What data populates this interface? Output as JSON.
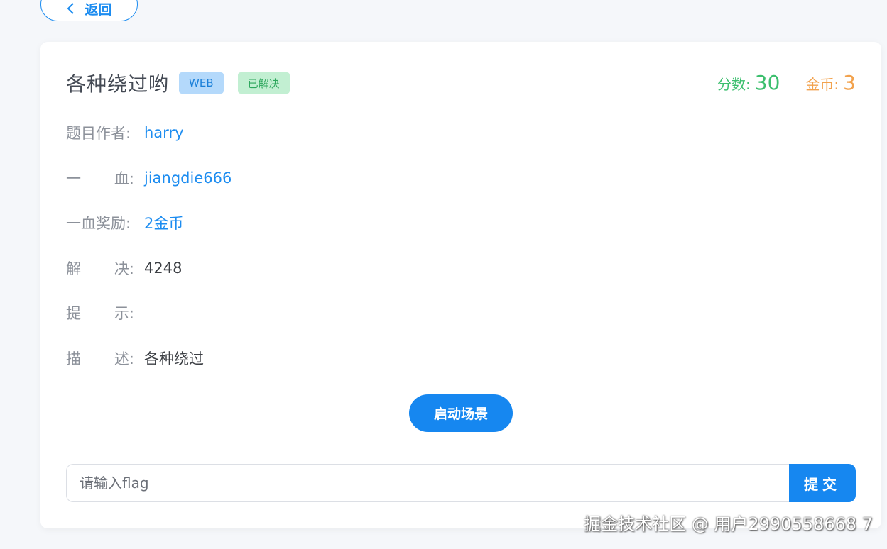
{
  "back": {
    "label": "返回",
    "icon": "chevron-left-icon"
  },
  "challenge": {
    "title": "各种绕过哟",
    "category_tag": "WEB",
    "status_tag": "已解决",
    "score_label": "分数:",
    "score_value": "30",
    "coin_label": "金币:",
    "coin_value": "3"
  },
  "info": {
    "author_label": "题目作者:",
    "author_value": "harry",
    "first_blood_label_a": "一",
    "first_blood_label_b": "血:",
    "first_blood_value": "jiangdie666",
    "first_blood_reward_label": "一血奖励:",
    "first_blood_reward_value": "2金币",
    "solved_label_a": "解",
    "solved_label_b": "决:",
    "solved_value": "4248",
    "hint_label_a": "提",
    "hint_label_b": "示:",
    "hint_value": "",
    "desc_label_a": "描",
    "desc_label_b": "述:",
    "desc_value": "各种绕过"
  },
  "actions": {
    "launch_label": "启动场景",
    "flag_placeholder": "请输入flag",
    "flag_value": "",
    "submit_label": "提交"
  },
  "watermark": "掘金技术社区 @ 用户2990558668 7",
  "colors": {
    "primary": "#1687f0",
    "link": "#1c8cf0",
    "score": "#3cbf6e",
    "coin": "#f2a24d",
    "web_tag_bg": "#b4d9fb",
    "solved_tag_bg": "#c2efd2"
  }
}
